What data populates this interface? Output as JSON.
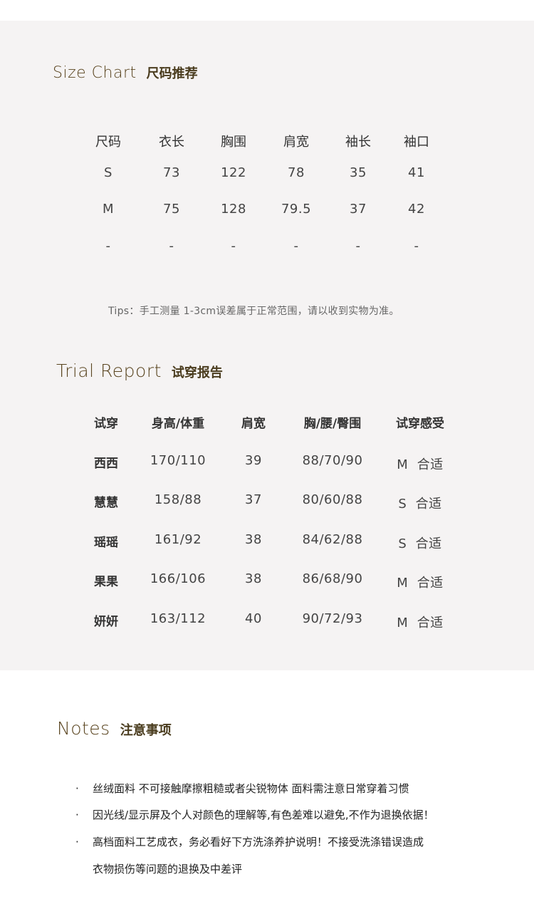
{
  "size_chart": {
    "title_en": "Size Chart",
    "title_zh": "尺码推荐",
    "headers": [
      "尺码",
      "衣长",
      "胸围",
      "肩宽",
      "袖长",
      "袖口"
    ],
    "rows": [
      [
        "S",
        "73",
        "122",
        "78",
        "35",
        "41"
      ],
      [
        "M",
        "75",
        "128",
        "79.5",
        "37",
        "42"
      ],
      [
        "-",
        "-",
        "-",
        "-",
        "-",
        "-"
      ]
    ],
    "tips": "Tips：手工测量 1-3cm误差属于正常范围，请以收到实物为准。"
  },
  "trial_report": {
    "title_en": "Trial Report",
    "title_zh": "试穿报告",
    "headers": [
      "试穿",
      "身高/体重",
      "肩宽",
      "胸/腰/臀围",
      "试穿感受"
    ],
    "rows": [
      [
        "西西",
        "170/110",
        "39",
        "88/70/90",
        "M  合适"
      ],
      [
        "慧慧",
        "158/88",
        "37",
        "80/60/88",
        "S  合适"
      ],
      [
        "瑶瑶",
        "161/92",
        "38",
        "84/62/88",
        "S  合适"
      ],
      [
        "果果",
        "166/106",
        "38",
        "86/68/90",
        "M  合适"
      ],
      [
        "妍妍",
        "163/112",
        "40",
        "90/72/93",
        "M  合适"
      ]
    ]
  },
  "notes": {
    "title_en": "Notes",
    "title_zh": "注意事项",
    "bullet": "·",
    "items": [
      "丝绒面料 不可接触摩擦粗糙或者尖锐物体 面料需注意日常穿着习惯",
      "因光线/显示屏及个人对颜色的理解等,有色差难以避免,不作为退换依据！",
      "高档面料工艺成衣，务必看好下方洗涤养护说明！不接受洗涤错误造成"
    ],
    "continuation": "衣物损伤等问题的退换及中差评"
  }
}
